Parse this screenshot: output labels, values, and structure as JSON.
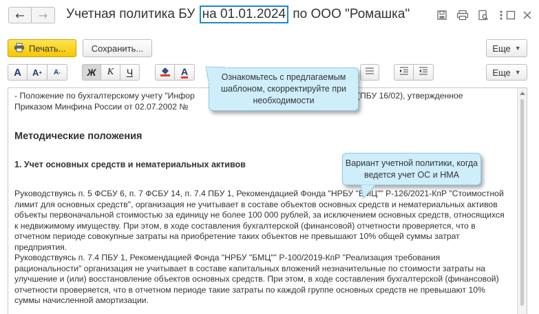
{
  "window": {
    "title_prefix": "Учетная политика БУ",
    "title_highlight": "на 01.01.2024",
    "title_suffix": "по ООО \"Ромашка\""
  },
  "nav": {
    "back_icon": "arrow-left-icon",
    "forward_icon": "arrow-right-icon"
  },
  "window_icons": [
    "save-icon",
    "print-icon",
    "preview-icon",
    "more-vertical-icon",
    "maximize-icon",
    "close-icon"
  ],
  "toolbar": {
    "print_label": "Печать...",
    "save_label": "Сохранить...",
    "more_label": "Еще",
    "more_label_2": "Еще"
  },
  "format_toolbar": {
    "font_a": "A",
    "bold": "Ж",
    "italic": "К",
    "underline": "Ч",
    "text_color": "A"
  },
  "document": {
    "line1": "- Положение по бухгалтерскому учету \"Инфор",
    "line1_end": "сти\" (ПБУ 16/02), утвержденное",
    "line2": "Приказом Минфина России от 02.07.2002 №",
    "heading": "Методические положения",
    "section_title": "1. Учет основных средств и нематериальных активов",
    "para1": "Руководствуясь п. 5 ФСБУ 6, п. 7 ФСБУ 14, п. 7.4 ПБУ 1, Рекомендацией Фонда \"НРБУ \"БМЦ\"\" Р-126/2021-КпР \"Стоимостной лимит для основных средств\", организация не учитывает в составе объектов основных средств и нематериальных активов объекты первоначальной стоимостью за единицу не более 100 000 рублей, за исключением основных средств, относящихся к недвижимому имуществу. При этом, в ходе составления бухгалтерской (финансовой) отчетности проверяется, что в отчетном периоде совокупные затраты на приобретение таких объектов не превышают 10% общей суммы затрат предприятия.",
    "para2": "Руководствуясь п. 7.4 ПБУ 1, Рекомендацией Фонда \"НРБУ \"БМЦ\"\" Р-100/2019-КпР \"Реализация требования рациональности\" организация не учитывает в составе капитальных вложений незначительные по стоимости затраты на улучшение и (или) восстановление объектов основных средств. При этом, в ходе составления бухгалтерской (финансовой) отчетности проверяется, что в отчетном периоде такие затраты по каждой группе основных средств не превышают 10% суммы начисленной амортизации."
  },
  "callouts": {
    "hint1": "Ознакомьтесь с предлагаемым шаблоном, скорректируйте при необходимости",
    "hint2": "Вариант учетной политики, когда ведется учет ОС и НМА"
  }
}
